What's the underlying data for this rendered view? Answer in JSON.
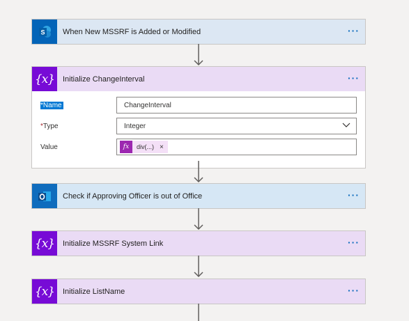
{
  "cards": [
    {
      "title": "When New MSSRF is Added or Modified",
      "icon": "sharepoint-icon",
      "more": "···"
    },
    {
      "title": "Initialize ChangeInterval",
      "icon": "variable-icon",
      "more": "···"
    },
    {
      "title": "Check if Approving Officer is out of Office",
      "icon": "outlook-icon",
      "more": "···"
    },
    {
      "title": "Initialize MSSRF System Link",
      "icon": "variable-icon",
      "more": "···"
    },
    {
      "title": "Initialize ListName",
      "icon": "variable-icon",
      "more": "···"
    }
  ],
  "fields": {
    "name": {
      "required_mark": "*",
      "label": "Name",
      "value": "ChangeInterval"
    },
    "type": {
      "required_mark": "*",
      "label": "Type",
      "value": "Integer"
    },
    "value": {
      "label": "Value",
      "token_icon": "fx",
      "token_text": "div(...)",
      "token_close": "×"
    }
  },
  "colors": {
    "sharepoint": "#0364b8",
    "variable": "#770bd6",
    "outlook": "#0f6cbd",
    "link": "#0f6cbd"
  }
}
